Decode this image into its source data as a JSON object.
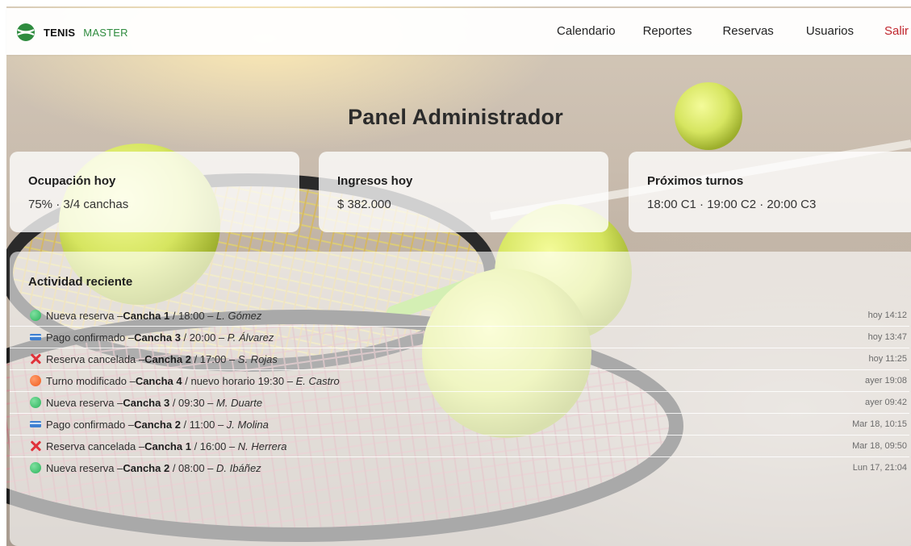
{
  "brand": {
    "name_bold": "TENIS",
    "name_accent": "MASTER",
    "logo_icon": "tennis-ball-icon"
  },
  "nav": [
    {
      "label": "Calendario"
    },
    {
      "label": "Reportes"
    },
    {
      "label": "Reservas"
    },
    {
      "label": "Usuarios"
    },
    {
      "label": "Salir",
      "color": "#c0262d"
    }
  ],
  "page_title": "Panel Administrador",
  "stats": [
    {
      "label": "Ocupación hoy",
      "value": "75% · 3/4 canchas"
    },
    {
      "label": "Ingresos hoy",
      "value": "$ 382.000"
    },
    {
      "label": "Próximos turnos",
      "value": "18:00 C1 · 19:00 C2 · 20:00 C3"
    }
  ],
  "activity": {
    "heading": "Actividad reciente",
    "items": [
      {
        "icon": "green-dot-icon",
        "action": "Nueva reserva – ",
        "court": "Cancha 1",
        "detail": " / 18:00 – ",
        "user": "L. Gómez",
        "time": "hoy 14:12"
      },
      {
        "icon": "credit-card-icon",
        "action": "Pago confirmado – ",
        "court": "Cancha 3",
        "detail": " / 20:00 – ",
        "user": "P. Álvarez",
        "time": "hoy 13:47"
      },
      {
        "icon": "cross-icon",
        "action": "Reserva cancelada – ",
        "court": "Cancha 2",
        "detail": " / 17:00 – ",
        "user": "S. Rojas",
        "time": "hoy 11:25"
      },
      {
        "icon": "orange-dot-icon",
        "action": "Turno modificado – ",
        "court": "Cancha 4",
        "detail": " / nuevo horario 19:30 – ",
        "user": "E. Castro",
        "time": "ayer 19:08"
      },
      {
        "icon": "green-dot-icon",
        "action": "Nueva reserva – ",
        "court": "Cancha 3",
        "detail": " / 09:30 – ",
        "user": "M. Duarte",
        "time": "ayer 09:42"
      },
      {
        "icon": "credit-card-icon",
        "action": "Pago confirmado – ",
        "court": "Cancha 2",
        "detail": " / 11:00 – ",
        "user": "J. Molina",
        "time": "Mar 18, 10:15"
      },
      {
        "icon": "cross-icon",
        "action": "Reserva cancelada – ",
        "court": "Cancha 1",
        "detail": " / 16:00 – ",
        "user": "N. Herrera",
        "time": "Mar 18, 09:50"
      },
      {
        "icon": "green-dot-icon",
        "action": "Nueva reserva – ",
        "court": "Cancha 2",
        "detail": " / 08:00 – ",
        "user": "D. Ibáñez",
        "time": "Lun 17, 21:04"
      }
    ]
  },
  "colors": {
    "accent_green": "#2e8b3e",
    "logout_red": "#c0262d",
    "cancel_red": "#e0323a",
    "card_blue": "#3d7fd1",
    "dot_orange": "#f05a1c"
  }
}
